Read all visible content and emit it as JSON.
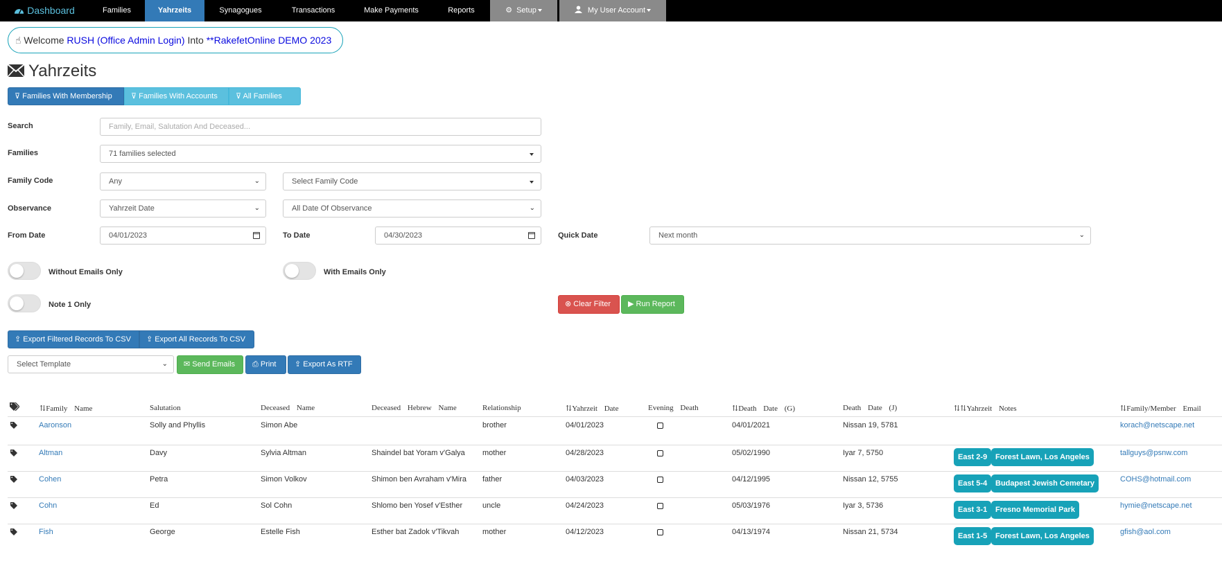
{
  "nav": {
    "brand": "Dashboard",
    "items": [
      "Families",
      "Yahrzeits",
      "Synagogues",
      "Transactions",
      "Make Payments",
      "Reports"
    ],
    "setup": "Setup",
    "account": "My User Account"
  },
  "welcome": {
    "prefix": "Welcome",
    "user": "RUSH (Office Admin Login)",
    "into": "Into",
    "org": "**RakefetOnline DEMO 2023"
  },
  "page_title": "Yahrzeits",
  "filter_buttons": [
    "Families With Membership",
    "Families With Accounts",
    "All Families"
  ],
  "form": {
    "search_label": "Search",
    "search_placeholder": "Family, Email, Salutation And Deceased...",
    "families_label": "Families",
    "families_value": "71 families selected",
    "family_code_label": "Family Code",
    "family_code_value": "Any",
    "family_code_select": "Select Family Code",
    "observance_label": "Observance",
    "observance_value": "Yahrzeit Date",
    "observance_select": "All Date Of Observance",
    "from_label": "From Date",
    "from_value": "04/01/2023",
    "to_label": "To Date",
    "to_value": "04/30/2023",
    "quick_label": "Quick Date",
    "quick_value": "Next month",
    "without_emails": "Without Emails Only",
    "with_emails": "With Emails Only",
    "note1": "Note 1 Only",
    "clear": "Clear Filter",
    "run": "Run Report"
  },
  "export": {
    "filtered": "Export Filtered Records To CSV",
    "all": "Export All Records To CSV",
    "template": "Select Template",
    "send": "Send Emails",
    "print": "Print",
    "rtf": "Export As RTF"
  },
  "table": {
    "headers": {
      "family": "Family Name",
      "salutation": "Salutation",
      "deceased": "Deceased Name",
      "hebrew": "Deceased Hebrew Name",
      "relationship": "Relationship",
      "yahrzeit": "Yahrzeit Date",
      "evening": "Evening Death",
      "death_g": "Death Date (G)",
      "death_j": "Death Date (J)",
      "notes": "Yahrzeit Notes",
      "email": "Family/Member Email"
    },
    "rows": [
      {
        "family": "Aaronson",
        "salutation": "Solly and Phyllis",
        "deceased": "Simon Abe",
        "hebrew": "",
        "relationship": "brother",
        "yahrzeit": "04/01/2023",
        "death_g": "04/01/2021",
        "death_j": "Nissan 19, 5781",
        "note1": "",
        "note2": "",
        "email": "korach@netscape.net"
      },
      {
        "family": "Altman",
        "salutation": "Davy",
        "deceased": "Sylvia Altman",
        "hebrew": "Shaindel bat Yoram v'Galya",
        "relationship": "mother",
        "yahrzeit": "04/28/2023",
        "death_g": "05/02/1990",
        "death_j": "Iyar 7, 5750",
        "note1": "East 2-9",
        "note2": "Forest Lawn, Los Angeles",
        "email": "tallguys@psnw.com"
      },
      {
        "family": "Cohen",
        "salutation": "Petra",
        "deceased": "Simon Volkov",
        "hebrew": "Shimon ben Avraham v'Mira",
        "relationship": "father",
        "yahrzeit": "04/03/2023",
        "death_g": "04/12/1995",
        "death_j": "Nissan 12, 5755",
        "note1": "East 5-4",
        "note2": "Budapest Jewish Cemetary",
        "email": "COHS@hotmail.com"
      },
      {
        "family": "Cohn",
        "salutation": "Ed",
        "deceased": "Sol Cohn",
        "hebrew": "Shlomo ben Yosef v'Esther",
        "relationship": "uncle",
        "yahrzeit": "04/24/2023",
        "death_g": "05/03/1976",
        "death_j": "Iyar 3, 5736",
        "note1": "East 3-1",
        "note2": "Fresno Memorial Park",
        "email": "hymie@netscape.net"
      },
      {
        "family": "Fish",
        "salutation": "George",
        "deceased": "Estelle Fish",
        "hebrew": "Esther bat Zadok v'Tikvah",
        "relationship": "mother",
        "yahrzeit": "04/12/2023",
        "death_g": "04/13/1974",
        "death_j": "Nissan 21, 5734",
        "note1": "East 1-5",
        "note2": "Forest Lawn, Los Angeles",
        "email": "gfish@aol.com"
      }
    ]
  },
  "colors": {
    "accent": "#337ab7",
    "info": "#5bc0de",
    "badge": "#17a2b8",
    "danger": "#d9534f",
    "success": "#5cb85c"
  }
}
